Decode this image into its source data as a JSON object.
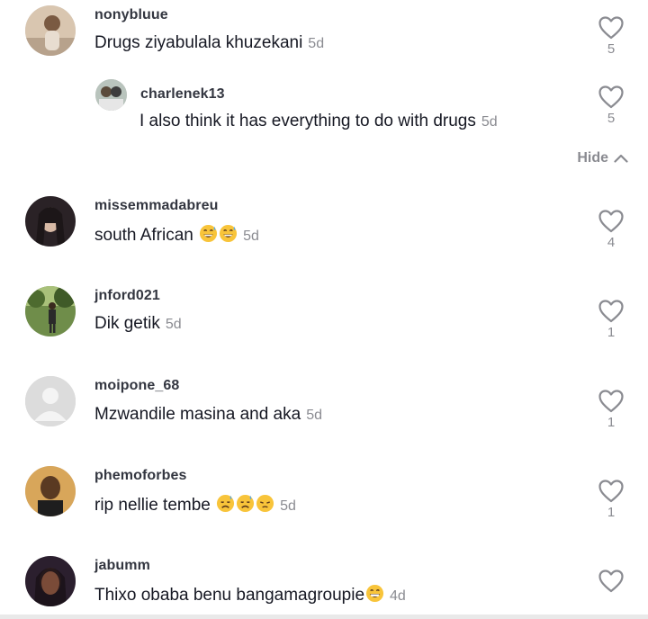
{
  "comments": [
    {
      "username": "nonybluue",
      "text": "Drugs ziyabulala khuzekani",
      "emojis": [],
      "time": "5d",
      "likes": "5",
      "avatar_color": "#b08a6a"
    },
    {
      "username": "charlenek13",
      "text": "I also think it has everything to do with drugs",
      "emojis": [],
      "time": "5d",
      "likes": "5",
      "avatar_color": "#8a9a8a"
    },
    {
      "username": "missemmadabreu",
      "text": "south African",
      "emojis": [
        "grin-sweat",
        "grin-sweat"
      ],
      "time": "5d",
      "likes": "4",
      "avatar_color": "#4a3a3a"
    },
    {
      "username": "jnford021",
      "text": "Dik getik",
      "emojis": [],
      "time": "5d",
      "likes": "1",
      "avatar_color": "#5f7a3f"
    },
    {
      "username": "moipone_68",
      "text": "Mzwandile masina and aka",
      "emojis": [],
      "time": "5d",
      "likes": "1",
      "avatar_color": "#d8d8d8"
    },
    {
      "username": "phemoforbes",
      "text": "rip nellie tembe",
      "emojis": [
        "sad-sweat",
        "sad-sweat",
        "pensive"
      ],
      "time": "5d",
      "likes": "1",
      "avatar_color": "#6b4a2a"
    },
    {
      "username": "jabumm",
      "text": "Thixo obaba benu bangamagroupie",
      "emojis": [
        "grin"
      ],
      "time": "4d",
      "likes": "",
      "avatar_color": "#3a2a3a"
    }
  ],
  "hide_label": "Hide"
}
